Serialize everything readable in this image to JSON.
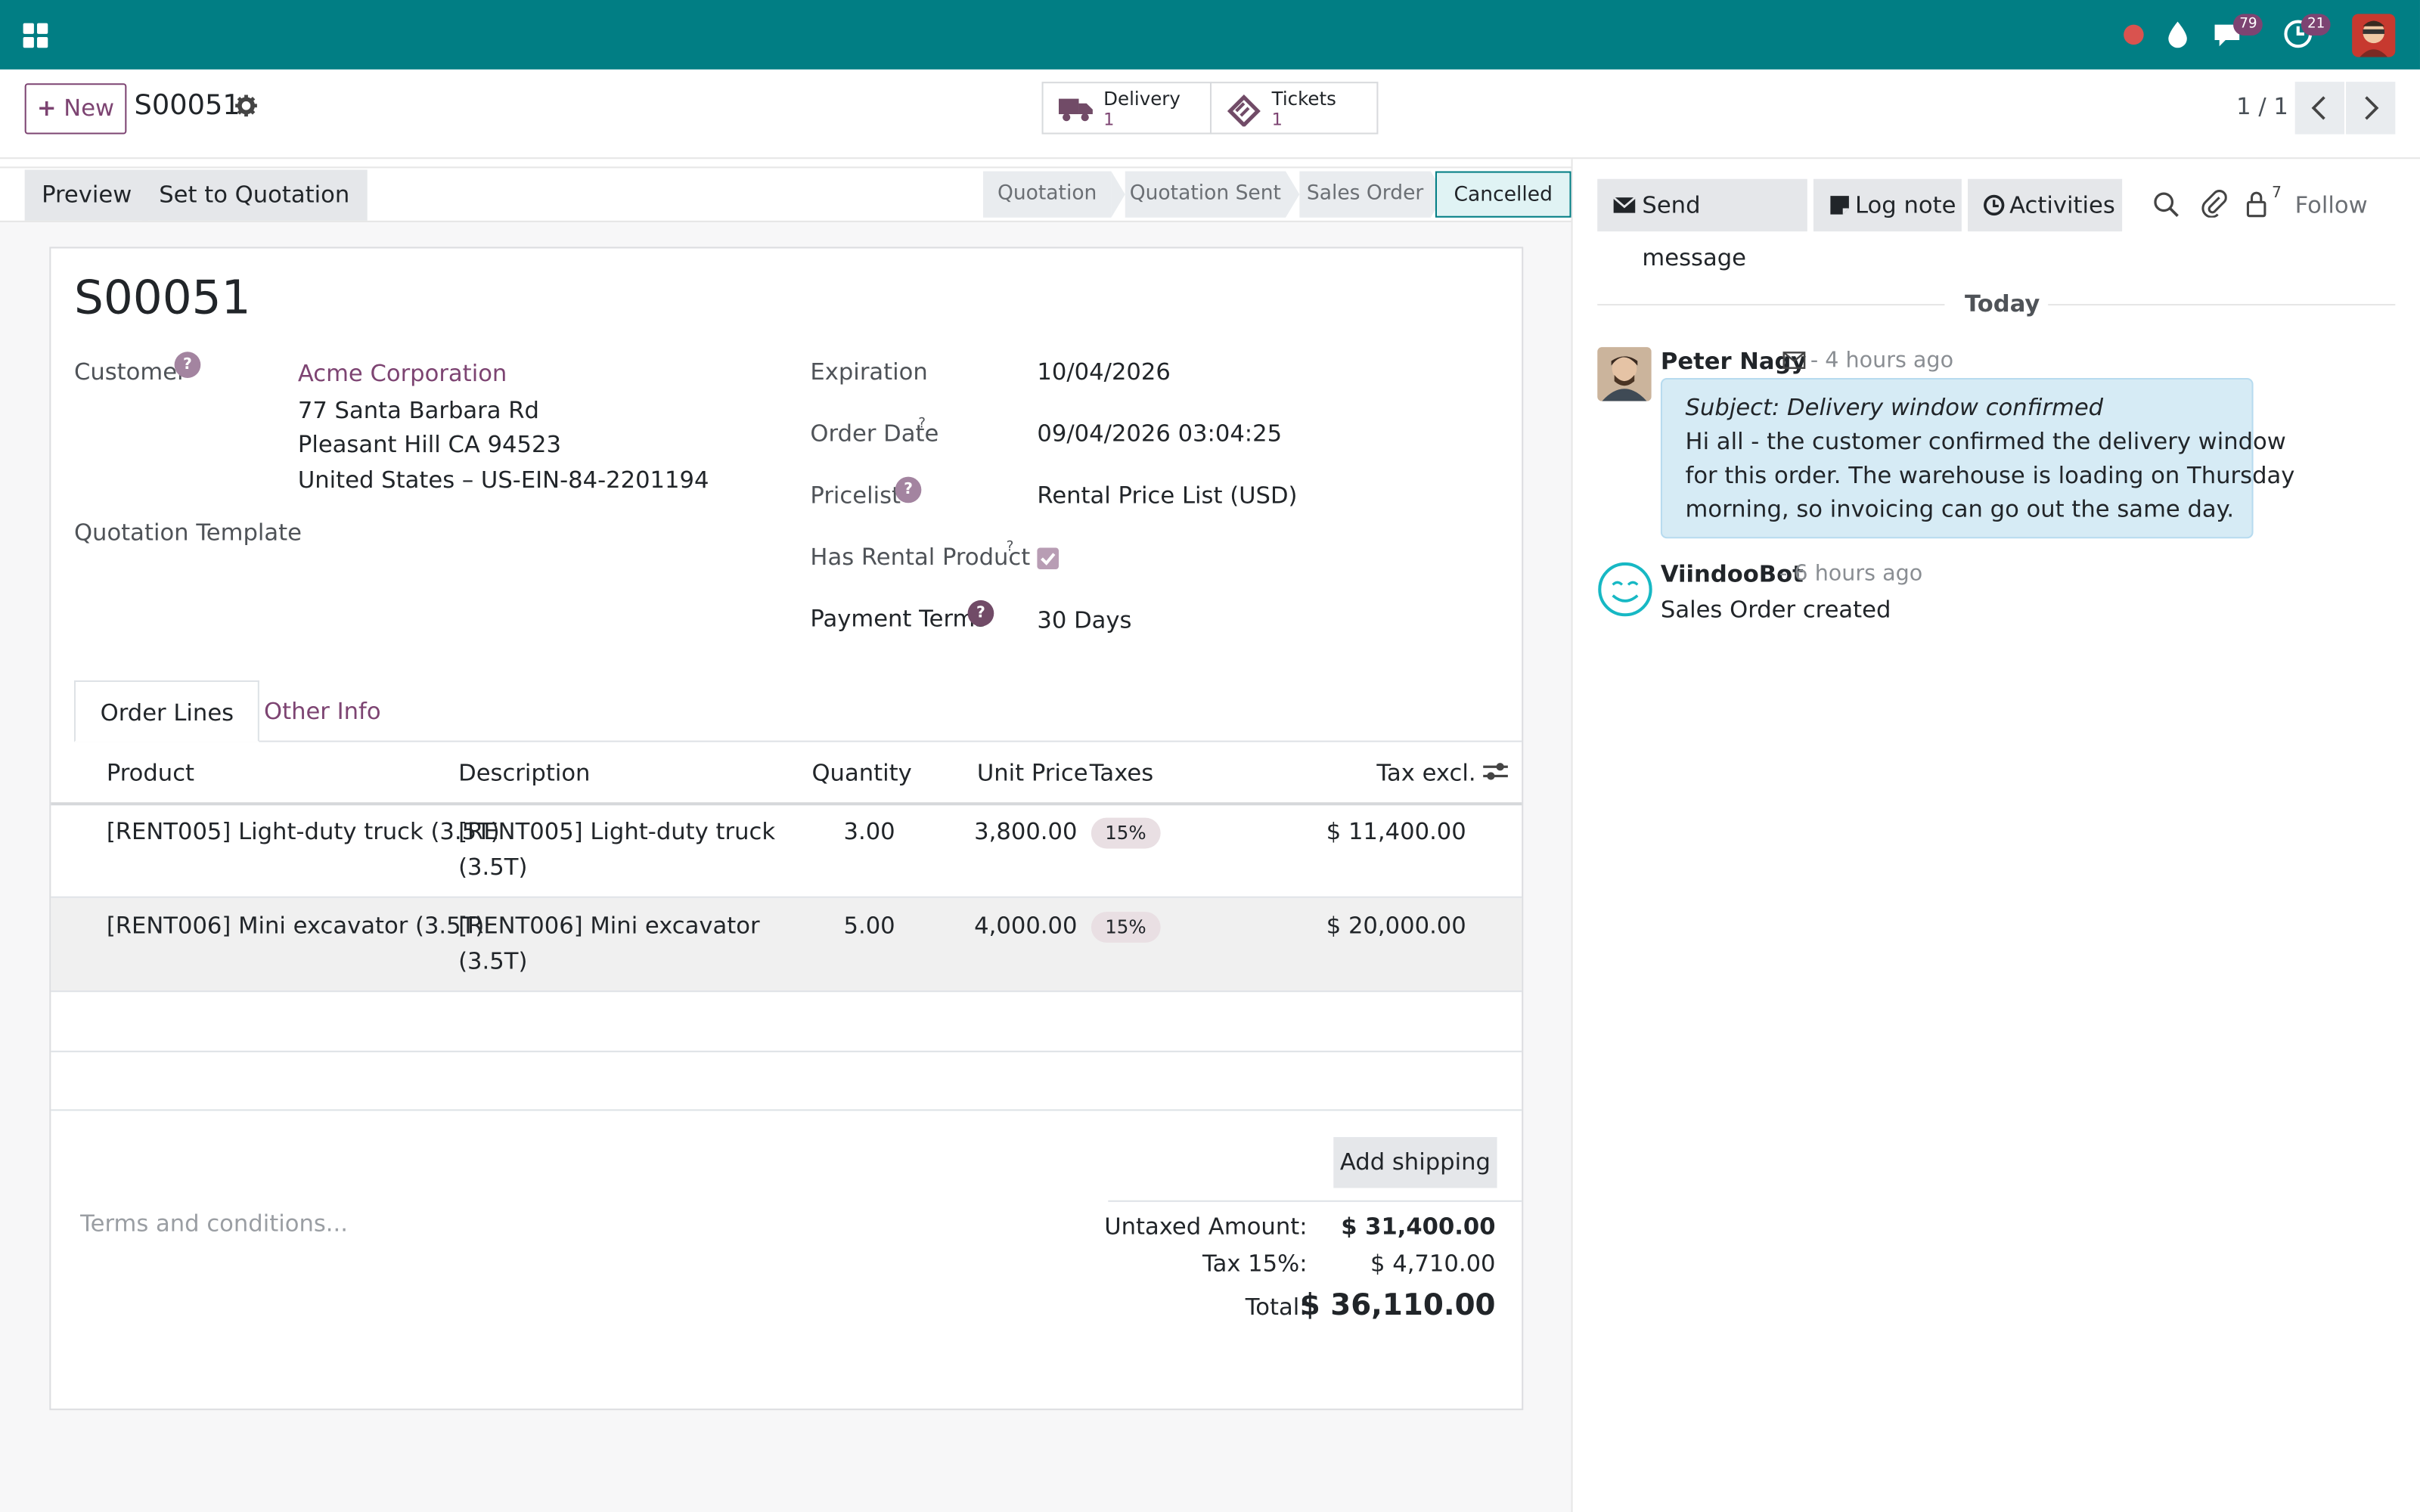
{
  "navbar": {
    "chat_count": "79",
    "activity_count": "21"
  },
  "control_panel": {
    "new_label": "New",
    "record_ref": "S00051",
    "smart_buttons": [
      {
        "label": "Delivery",
        "count": "1",
        "icon": "truck-icon"
      },
      {
        "label": "Tickets",
        "count": "1",
        "icon": "ticket-icon"
      }
    ],
    "pager": "1 / 1"
  },
  "statusbar": {
    "buttons": [
      "Preview",
      "Set to Quotation"
    ],
    "stages": [
      "Quotation",
      "Quotation Sent",
      "Sales Order",
      "Cancelled"
    ],
    "active_stage": "Cancelled"
  },
  "form": {
    "title": "S00051",
    "customer_label": "Customer",
    "customer_name": "Acme Corporation",
    "address_line1": "77 Santa Barbara Rd",
    "address_line2": "Pleasant Hill CA 94523",
    "address_line3": "United States – US-EIN-84-2201194",
    "quotation_template_label": "Quotation Template",
    "expiration_label": "Expiration",
    "expiration_value": "10/04/2026",
    "order_date_label": "Order Date",
    "order_date_value": "09/04/2026 03:04:25",
    "pricelist_label": "Pricelist",
    "pricelist_value": "Rental Price List (USD)",
    "has_rental_label": "Has Rental Product",
    "has_rental_value": true,
    "payment_terms_label": "Payment Terms",
    "payment_terms_value": "30 Days",
    "help_mark": "?"
  },
  "tabs": [
    "Order Lines",
    "Other Info"
  ],
  "order_lines": {
    "columns": [
      "Product",
      "Description",
      "Quantity",
      "Unit Price",
      "Taxes",
      "Tax excl."
    ],
    "rows": [
      {
        "product": "[RENT005] Light-duty truck (3.5T)",
        "desc1": "[RENT005] Light-duty truck",
        "desc2": "(3.5T)",
        "qty": "3.00",
        "price": "3,800.00",
        "tax": "15%",
        "subtotal": "$ 11,400.00"
      },
      {
        "product": "[RENT006] Mini excavator (3.5T)",
        "desc1": "[RENT006] Mini excavator",
        "desc2": "(3.5T)",
        "qty": "5.00",
        "price": "4,000.00",
        "tax": "15%",
        "subtotal": "$ 20,000.00"
      }
    ]
  },
  "footer": {
    "terms_placeholder": "Terms and conditions...",
    "add_shipping_label": "Add shipping",
    "untaxed_label": "Untaxed Amount:",
    "untaxed_value": "$ 31,400.00",
    "tax_label": "Tax 15%:",
    "tax_value": "$ 4,710.00",
    "total_label": "Total:",
    "total_value": "$ 36,110.00"
  },
  "chatter": {
    "send_message": "Send message",
    "log_note": "Log note",
    "activities": "Activities",
    "followers_count": "7",
    "follow": "Follow",
    "date_sep": "Today",
    "messages": [
      {
        "author": "Peter Nagy",
        "time": "- 4 hours ago",
        "subject": "Subject: Delivery window confirmed",
        "body1": "Hi all - the customer confirmed the delivery window",
        "body2": "for this order. The warehouse is loading on Thursday",
        "body3": "morning, so invoicing can go out the same day."
      },
      {
        "author": "ViindooBot",
        "time": "- 6 hours ago",
        "body1": "Sales Order created"
      }
    ]
  }
}
